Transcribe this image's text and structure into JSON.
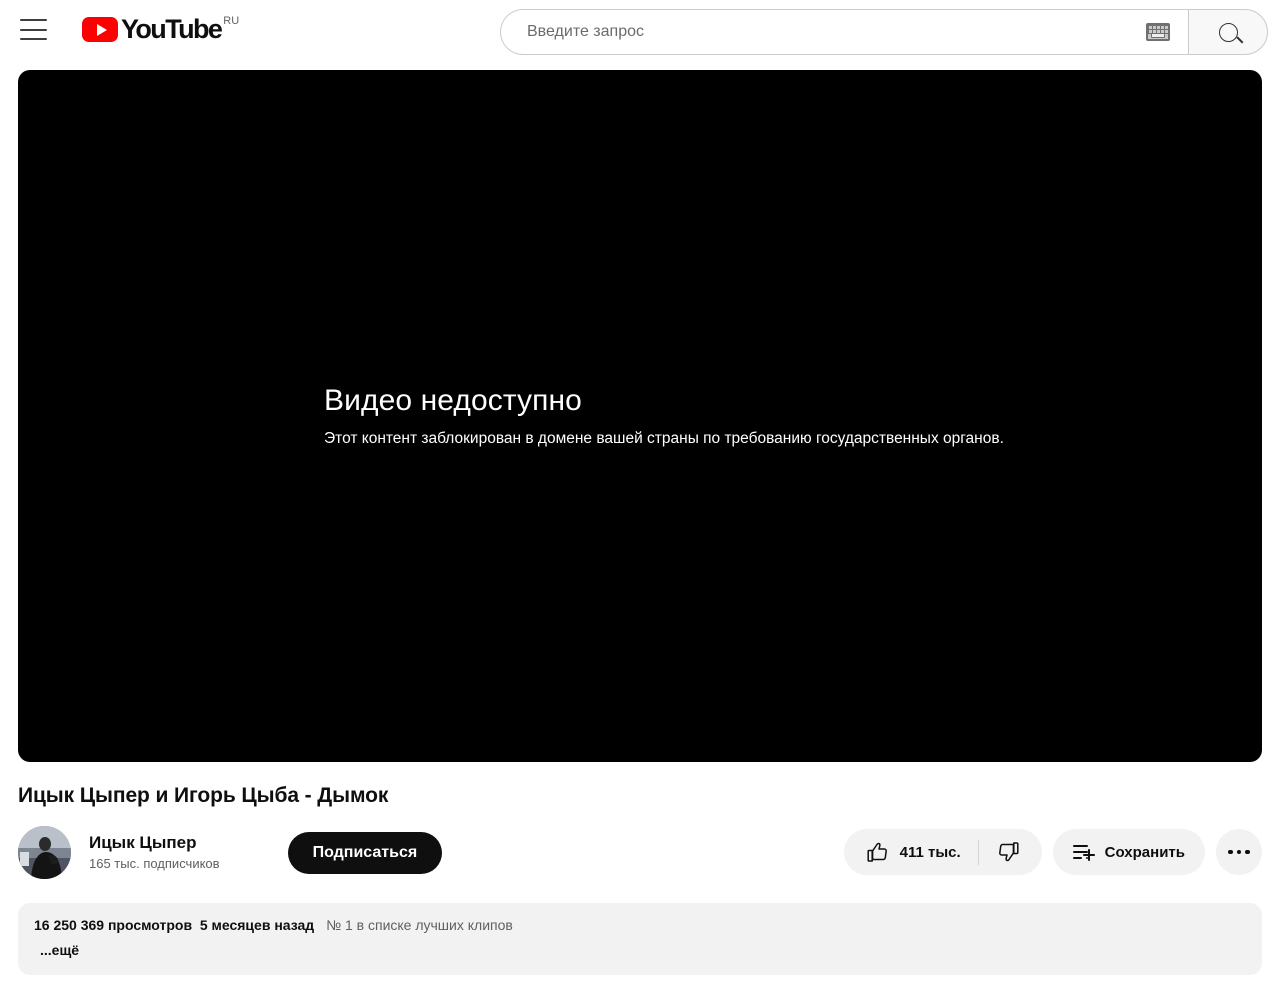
{
  "header": {
    "menu_icon": "hamburger-menu-icon",
    "logo_text": "YouTube",
    "logo_country": "RU",
    "search": {
      "placeholder": "Введите запрос",
      "value": "",
      "keyboard_icon": "keyboard-icon",
      "search_icon": "search-icon"
    }
  },
  "player": {
    "error_title": "Видео недоступно",
    "error_subtitle": "Этот контент заблокирован в домене вашей страны по требованию государственных органов.",
    "background_color": "#000000"
  },
  "video": {
    "title": "Ицык Цыпер и Игорь Цыба - Дымок"
  },
  "owner": {
    "name": "Ицык Цыпер",
    "subscribers": "165 тыс. подписчиков",
    "subscribe_label": "Подписаться",
    "avatar": "channel-avatar"
  },
  "actions": {
    "like_count": "411 тыс.",
    "like_icon": "thumbs-up-icon",
    "dislike_icon": "thumbs-down-icon",
    "save_label": "Сохранить",
    "save_icon": "playlist-add-icon",
    "more_icon": "more-options-icon"
  },
  "description": {
    "views": "16 250 369 просмотров",
    "published": "5 месяцев назад",
    "badge": "№ 1 в списке лучших клипов",
    "expand_label": "...ещё"
  },
  "colors": {
    "brand_red": "#ff0000",
    "text_primary": "#0f0f0f",
    "text_secondary": "#606060",
    "chip_bg": "#f2f2f2"
  }
}
